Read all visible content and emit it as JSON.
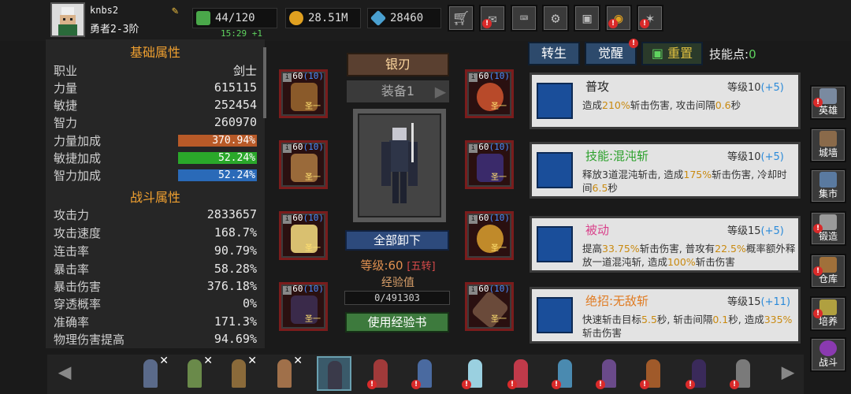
{
  "player": {
    "name": "knbs2",
    "rank": "勇者2-3阶"
  },
  "resources": {
    "energy": "44/120",
    "energy_timer": "15:29 +1",
    "gold": "28.51M",
    "gems": "28460"
  },
  "top_buttons": [
    {
      "name": "shop-button",
      "icon": "cart"
    },
    {
      "name": "mail-button",
      "icon": "envelope",
      "badge": "!"
    },
    {
      "name": "game-button",
      "icon": "gamepad"
    },
    {
      "name": "settings-button",
      "icon": "gear"
    },
    {
      "name": "gift-button",
      "icon": "gift"
    },
    {
      "name": "wheel-button",
      "icon": "wheel",
      "badge": "!"
    },
    {
      "name": "event-button",
      "icon": "fireworks",
      "badge": "!"
    }
  ],
  "stats": {
    "basic_title": "基础属性",
    "class_label": "职业",
    "class_value": "剑士",
    "strength_label": "力量",
    "strength": "615115",
    "agility_label": "敏捷",
    "agility": "252454",
    "intellect_label": "智力",
    "intellect": "260970",
    "str_bonus_label": "力量加成",
    "str_bonus": "370.94%",
    "agi_bonus_label": "敏捷加成",
    "agi_bonus": "52.24%",
    "int_bonus_label": "智力加成",
    "int_bonus": "52.24%",
    "combat_title": "战斗属性",
    "attack_label": "攻击力",
    "attack": "2833657",
    "atk_speed_label": "攻击速度",
    "atk_speed": "168.7%",
    "combo_label": "连击率",
    "combo": "90.79%",
    "crit_label": "暴击率",
    "crit": "58.28%",
    "crit_dmg_label": "暴击伤害",
    "crit_dmg": "376.18%",
    "pierce_label": "穿透概率",
    "pierce": "0%",
    "accuracy_label": "准确率",
    "accuracy": "171.3%",
    "phys_dmg_label": "物理伤害提高",
    "phys_dmg": "94.69%"
  },
  "equipment": {
    "weapon_name": "银刃",
    "set_label": "装备1",
    "slot_level": "60",
    "slot_sublevel": "(10)",
    "slot_tag": "圣一",
    "unequip_all": "全部卸下",
    "level_text": "等级:60",
    "transfer_text": "[五转]",
    "exp_label": "经验值",
    "exp_value": "0/491303",
    "use_exp_book": "使用经验书"
  },
  "skills_header": {
    "tab_transfer": "转生",
    "tab_awaken": "觉醒",
    "tab_reset": "重置",
    "points_label": "技能点:",
    "points": "0"
  },
  "skills": [
    {
      "name": "普攻",
      "name_color": "#222222",
      "level": "等级10",
      "bonus": "(+5)",
      "d1": "造成",
      "h1": "210%",
      "d2": "斩击伤害, 攻击间隔",
      "h2": "0.6",
      "d3": "秒",
      "d4": "",
      "h3": "",
      "d5": ""
    },
    {
      "name": "技能:混沌斩",
      "name_color": "#2aa02a",
      "level": "等级10",
      "bonus": "(+5)",
      "d1": "释放3道混沌斩击, 造成",
      "h1": "175%",
      "d2": "斩击伤害, 冷却时间",
      "h2": "6.5",
      "d3": "秒",
      "d4": "",
      "h3": "",
      "d5": ""
    },
    {
      "name": "被动",
      "name_color": "#d9408a",
      "level": "等级15",
      "bonus": "(+5)",
      "d1": "提高",
      "h1": "33.75%",
      "d2": "斩击伤害, 普攻有",
      "h2": "22.5%",
      "d3": "概率额外释放一道混沌斩, 造成",
      "h3": "100%",
      "d4": "斩击伤害",
      "d5": ""
    },
    {
      "name": "绝招:无敌斩",
      "name_color": "#e07a20",
      "level": "等级15",
      "bonus": "(+11)",
      "d1": "快速斩击目标",
      "h1": "5.5",
      "d2": "秒, 斩击间隔",
      "h2": "0.1",
      "d3": "秒, 造成",
      "h3": "335%",
      "d4": "斩击伤害",
      "d5": ""
    }
  ],
  "side_menu": [
    {
      "label": "英雄",
      "color": "#7a8aa0"
    },
    {
      "label": "城墙",
      "color": "#8a6a4a"
    },
    {
      "label": "集市",
      "color": "#5a7aa0"
    },
    {
      "label": "锻造",
      "color": "#9a9a9a"
    },
    {
      "label": "仓库",
      "color": "#a0703a"
    },
    {
      "label": "培养",
      "color": "#b0a040"
    },
    {
      "label": "战斗",
      "color": "#8a3ab0"
    }
  ],
  "colors": {
    "str_bar": "#b85a28",
    "agi_bar": "#2aa82a",
    "int_bar": "#2a6ab8",
    "accent": "#f0a030"
  }
}
